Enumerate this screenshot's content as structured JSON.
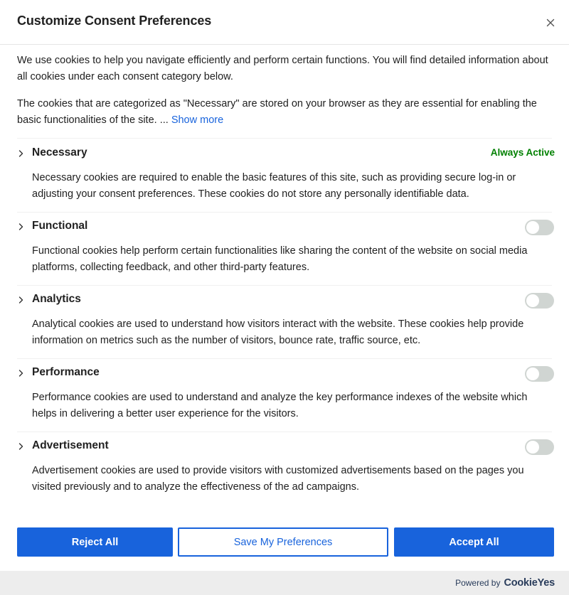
{
  "modal": {
    "title": "Customize Consent Preferences",
    "intro": "We use cookies to help you navigate efficiently and perform certain functions. You will find detailed information about all cookies under each consent category below.",
    "necessary_note": "The cookies that are categorized as \"Necessary\" are stored on your browser as they are essential for enabling the basic functionalities of the site. ... ",
    "show_more": "Show more"
  },
  "categories": [
    {
      "title": "Necessary",
      "status": "Always Active",
      "description": "Necessary cookies are required to enable the basic features of this site, such as providing secure log-in or adjusting your consent preferences. These cookies do not store any personally identifiable data."
    },
    {
      "title": "Functional",
      "enabled": false,
      "description": "Functional cookies help perform certain functionalities like sharing the content of the website on social media platforms, collecting feedback, and other third-party features."
    },
    {
      "title": "Analytics",
      "enabled": false,
      "description": "Analytical cookies are used to understand how visitors interact with the website. These cookies help provide information on metrics such as the number of visitors, bounce rate, traffic source, etc."
    },
    {
      "title": "Performance",
      "enabled": false,
      "description": "Performance cookies are used to understand and analyze the key performance indexes of the website which helps in delivering a better user experience for the visitors."
    },
    {
      "title": "Advertisement",
      "enabled": false,
      "description": "Advertisement cookies are used to provide visitors with customized advertisements based on the pages you visited previously and to analyze the effectiveness of the ad campaigns."
    }
  ],
  "buttons": {
    "reject": "Reject All",
    "save": "Save My Preferences",
    "accept": "Accept All"
  },
  "footer": {
    "powered_by": "Powered by",
    "brand": "CookieYes"
  },
  "colors": {
    "accent": "#1863dc",
    "always_active": "#008000",
    "toggle_off": "#d0d5d2",
    "footer_bg": "#ededed"
  },
  "icons": {
    "close": "close-icon",
    "expand": "chevron-right-icon"
  }
}
